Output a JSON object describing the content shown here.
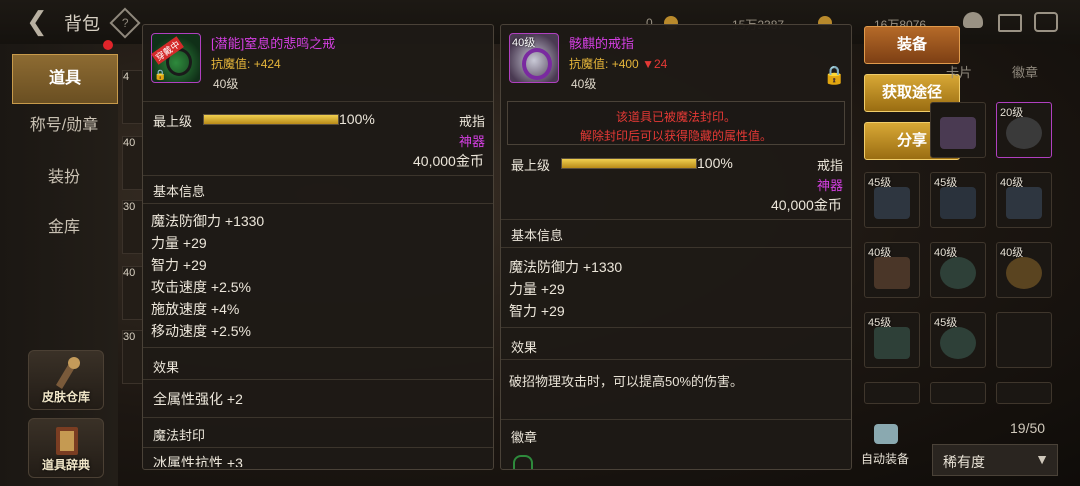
{
  "topbar": {
    "title": "背包",
    "res1": "0",
    "res2": "15万2387",
    "res3": "16万8076"
  },
  "sidebar": {
    "tabs": [
      {
        "label": "道具"
      },
      {
        "label": "称号/勋章"
      },
      {
        "label": "装扮"
      },
      {
        "label": "金库"
      }
    ],
    "skin_vault": "皮肤仓库",
    "item_dict": "道具辞典"
  },
  "left_slots": [
    "4",
    "40",
    "30",
    "40",
    "30"
  ],
  "tooltip1": {
    "badge": "穿戴中",
    "name": "[潜能]窒息的悲鸣之戒",
    "stat_line_label": "抗魔值:",
    "stat_line_value": "+424",
    "level": "40级",
    "grade": "最上级",
    "grade_pct": "100%",
    "grade_fill": 1.0,
    "slot_type": "戒指",
    "rarity": "神器",
    "price": "40,000金币",
    "basic_header": "基本信息",
    "stats": [
      "魔法防御力 +1330",
      "力量 +29",
      "智力 +29",
      "攻击速度 +2.5%",
      "施放速度 +4%",
      "移动速度 +2.5%"
    ],
    "effect_header": "效果",
    "effect_text": "全属性强化 +2",
    "seal_header": "魔法封印",
    "seal_partial": "冰属性抗性 +3"
  },
  "tooltip2": {
    "badge": "40级",
    "name": "骸麒的戒指",
    "stat_line_label": "抗魔值:",
    "stat_line_value": "+400",
    "stat_line_diff": "▼24",
    "level": "40级",
    "sealed_line1": "该道具已被魔法封印。",
    "sealed_line2": "解除封印后可以获得隐藏的属性值。",
    "grade": "最上级",
    "grade_pct": "100%",
    "grade_fill": 1.0,
    "slot_type": "戒指",
    "rarity": "神器",
    "price": "40,000金币",
    "basic_header": "基本信息",
    "stats": [
      "魔法防御力 +1330",
      "力量 +29",
      "智力 +29"
    ],
    "effect_header": "效果",
    "effect_text": "破招物理攻击时，可以提高50%的伤害。",
    "emblem_header": "徽章"
  },
  "actions": {
    "equip": "装备",
    "source": "获取途径",
    "share": "分享"
  },
  "right_panel": {
    "tab_partial": "卡片",
    "tab_emblem": "徽章",
    "grid_levels": [
      "",
      "20级",
      "45级",
      "45级",
      "40级",
      "40级",
      "40级",
      "40级",
      "45级",
      "45级"
    ],
    "capacity": "19/50",
    "auto_equip": "自动装备",
    "sort_label": "稀有度"
  },
  "colors": {
    "accent_gold": "#e5b53a",
    "rarity_magenta": "#d33fe1",
    "warning_red": "#e53935"
  }
}
